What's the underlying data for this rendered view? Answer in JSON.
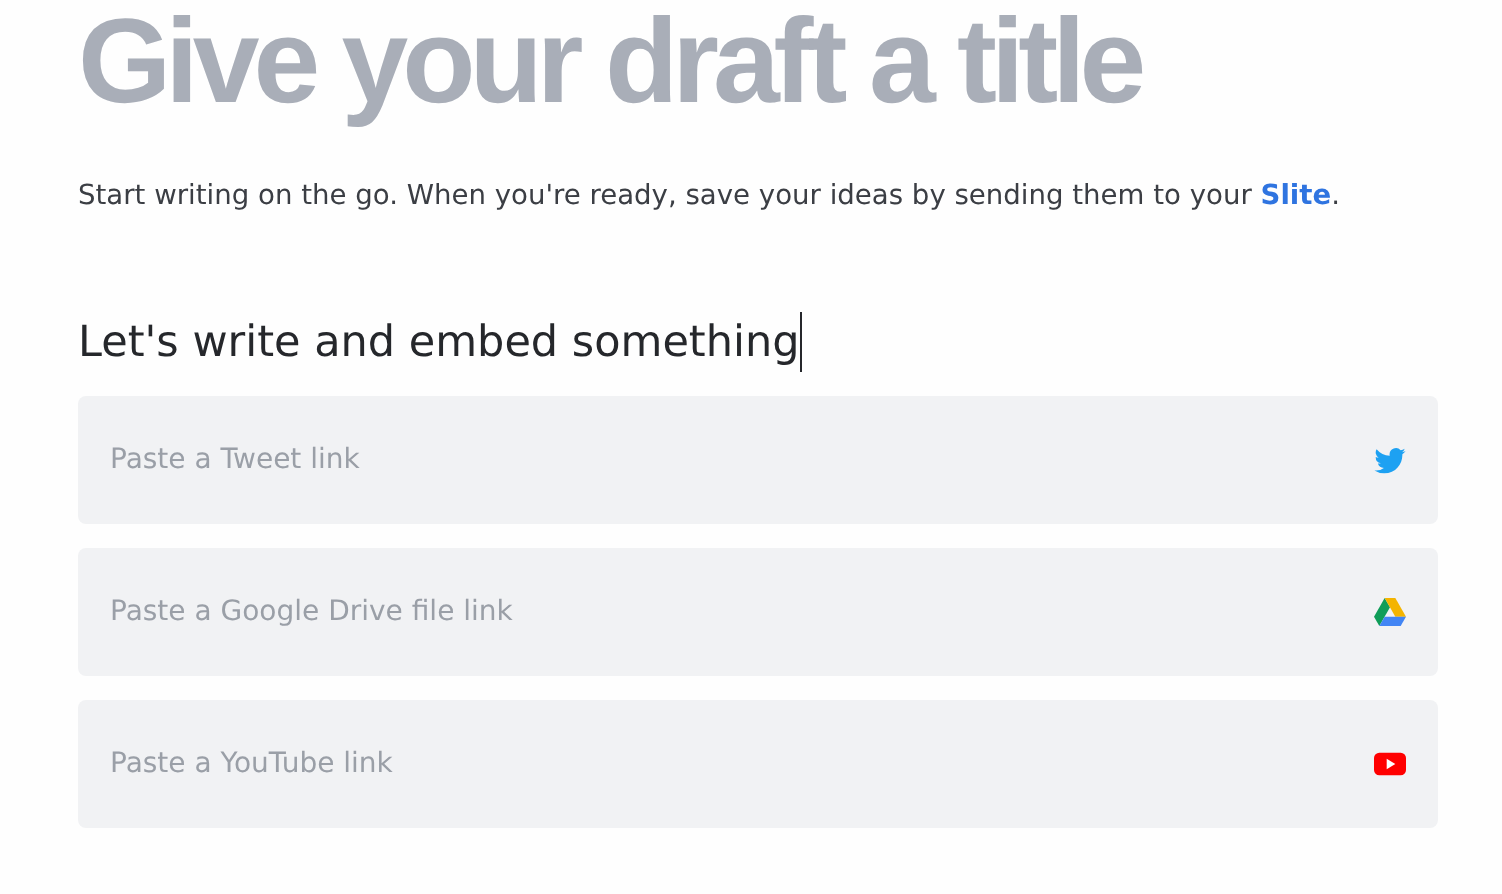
{
  "title": "Give your draft a title",
  "intro": {
    "before": "Start writing on the go. When you're ready, save your ideas by sending them to your ",
    "link": "Slite",
    "after": "."
  },
  "heading": {
    "text": "Let's write and embed something",
    "focused": true
  },
  "embeds": [
    {
      "kind": "twitter",
      "placeholder": "Paste a Tweet link"
    },
    {
      "kind": "drive",
      "placeholder": "Paste a Google Drive file link"
    },
    {
      "kind": "youtube",
      "placeholder": "Paste a YouTube link"
    }
  ]
}
